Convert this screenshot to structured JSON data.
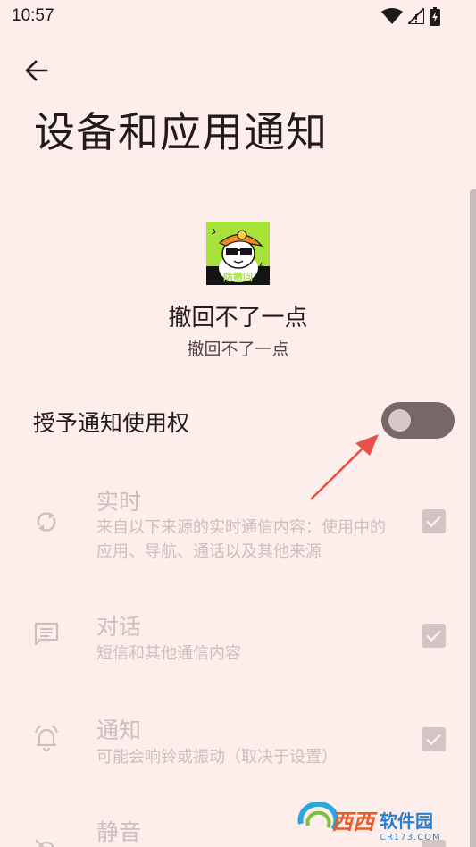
{
  "status_bar": {
    "time": "10:57"
  },
  "header": {
    "title": "设备和应用通知"
  },
  "app": {
    "icon_badge": "防撤回",
    "name": "撤回不了一点",
    "subtitle": "撤回不了一点"
  },
  "grant": {
    "label": "授予通知使用权",
    "enabled": false
  },
  "options": [
    {
      "title": "实时",
      "description": "来自以下来源的实时通信内容：使用中的应用、导航、通话以及其他来源",
      "icon": "sync-icon",
      "checked": true
    },
    {
      "title": "对话",
      "description": "短信和其他通信内容",
      "icon": "chat-icon",
      "checked": true
    },
    {
      "title": "通知",
      "description": "可能会响铃或振动（取决于设置）",
      "icon": "bell-icon",
      "checked": true
    },
    {
      "title": "静音",
      "description": "",
      "icon": "mute-icon",
      "checked": true
    }
  ],
  "watermark": {
    "brand": "西西软件园",
    "url": "CR173.COM"
  },
  "colors": {
    "background": "#fdeeeb",
    "toggle_track": "#776767",
    "arrow": "#e8504a",
    "disabled_text": "#ccbfbd"
  }
}
